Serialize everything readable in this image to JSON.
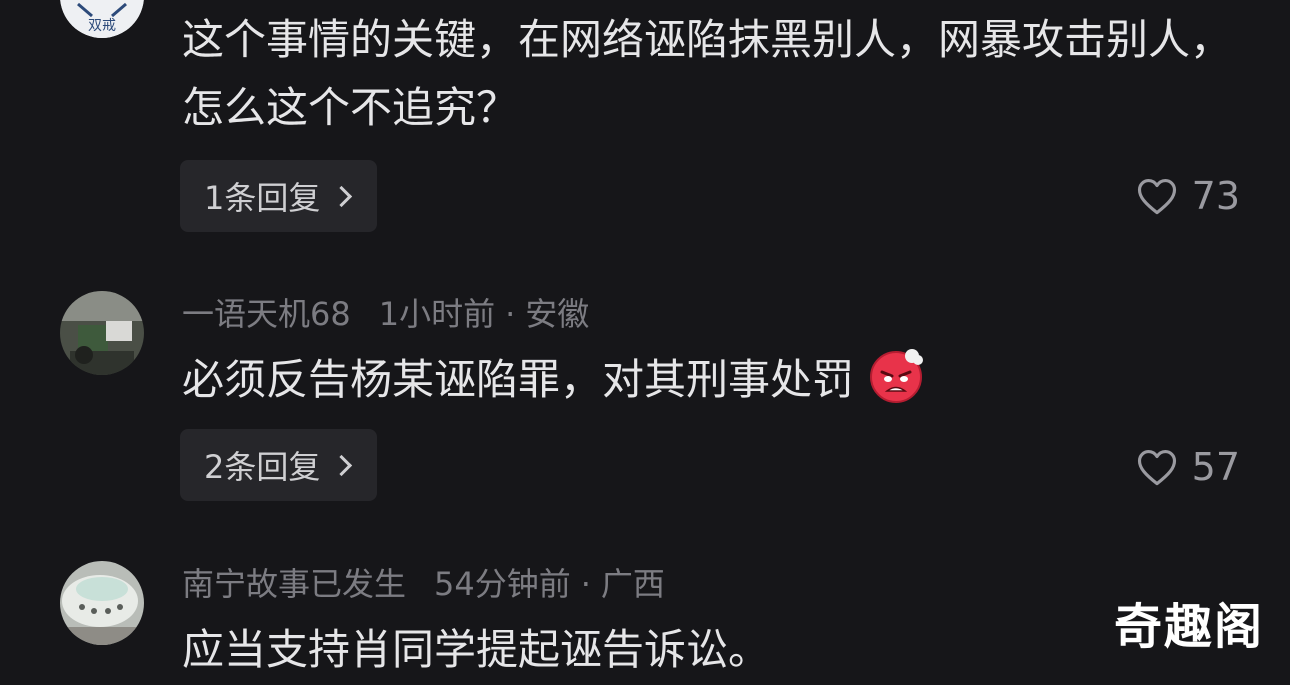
{
  "comments": [
    {
      "avatar": "double-quit-logo",
      "text": "这个事情的关键，在网络诬陷抹黑别人，网暴攻击别人，怎么这个不追究？",
      "reply_label": "1条回复",
      "likes": "73"
    },
    {
      "avatar": "photo-avatar",
      "username": "一语天机68",
      "time": "1小时前",
      "location": "安徽",
      "text": "必须反告杨某诬陷罪，对其刑事处罚",
      "reply_label": "2条回复",
      "likes": "57"
    },
    {
      "avatar": "photo-avatar",
      "username": "南宁故事已发生",
      "time": "54分钟前",
      "location": "广西",
      "text": "应当支持肖同学提起诬告诉讼。"
    }
  ],
  "logo_text": "双戒",
  "separator": "·",
  "watermark": "奇趣阁",
  "colors": {
    "background": "#161619",
    "text": "#e6e6e8",
    "meta": "#7c7c82",
    "button_bg": "#26262a"
  }
}
